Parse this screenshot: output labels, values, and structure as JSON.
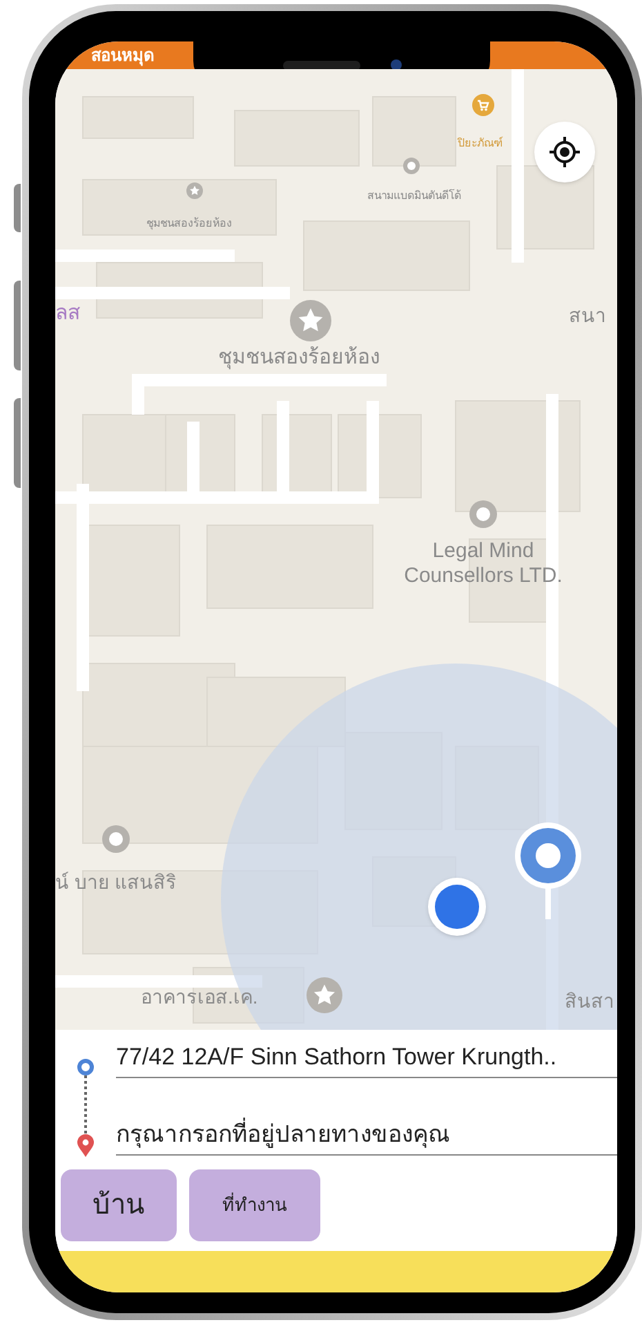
{
  "header": {
    "title": "สอนหมุด"
  },
  "map": {
    "labels": [
      {
        "kind": "shop",
        "text": "ปิยะภัณฑ์"
      },
      {
        "kind": "small",
        "text": "สนามแบดมินตันดีโด้"
      },
      {
        "kind": "small",
        "text": "ชุมชนสองร้อยห้อง"
      },
      {
        "kind": "district",
        "text": "ลส"
      },
      {
        "kind": "medium",
        "text": "สนา"
      },
      {
        "kind": "large",
        "text": "ชุมชนสองร้อยห้อง"
      },
      {
        "kind": "large",
        "text": "Legal Mind Counsellors LTD."
      },
      {
        "kind": "medium",
        "text": "น์ บาย แสนสิริ"
      },
      {
        "kind": "medium",
        "text": "อาคารเอส.เค."
      },
      {
        "kind": "medium",
        "text": "สินสา"
      }
    ]
  },
  "route": {
    "origin": {
      "value": "77/42 12A/F Sinn Sathorn Tower Krungth.."
    },
    "destination": {
      "placeholder": "กรุณากรอกที่อยู่ปลายทางของคุณ"
    }
  },
  "shortcuts": [
    {
      "label": "บ้าน",
      "kind": "large"
    },
    {
      "label": "ที่ทำงาน",
      "kind": "small"
    }
  ]
}
